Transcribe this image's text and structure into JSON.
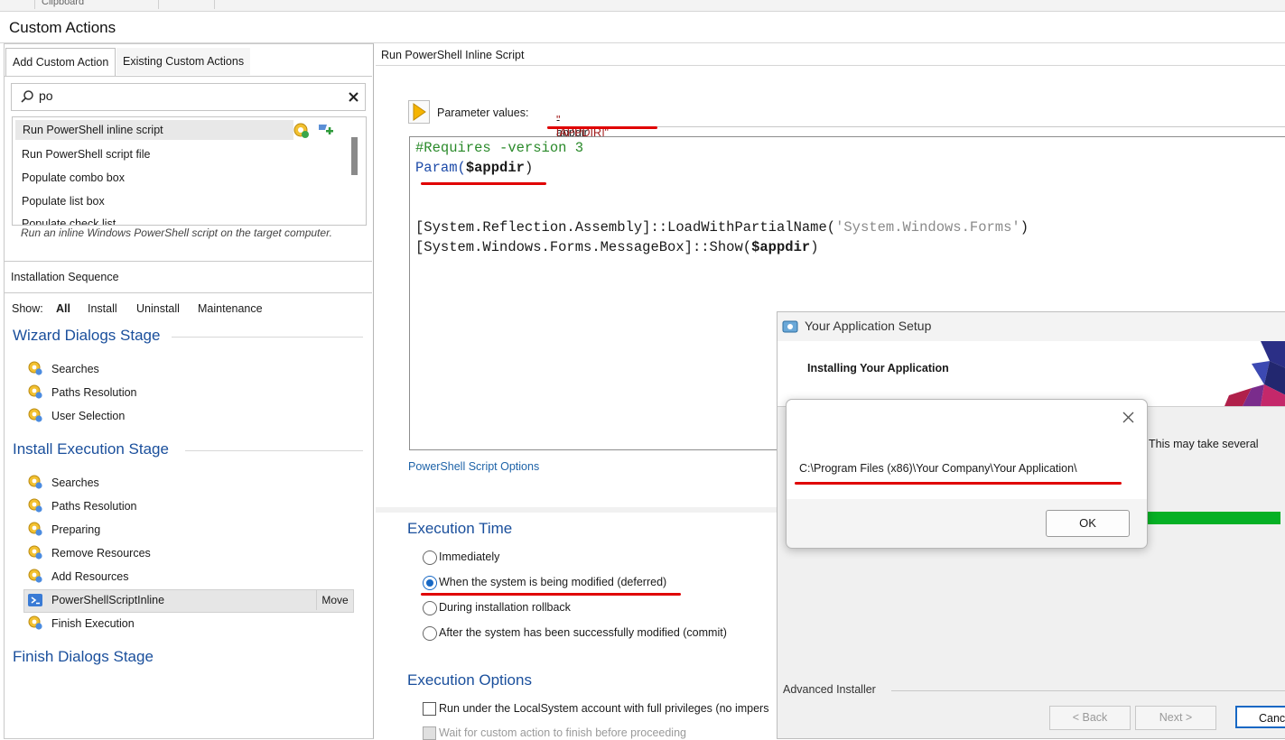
{
  "ribbon": {
    "group_label": "Clipboard"
  },
  "window_title": "Custom Actions",
  "left": {
    "tabs": [
      "Add Custom Action",
      "Existing Custom Actions"
    ],
    "search": {
      "value": "po"
    },
    "actions": [
      "Run PowerShell inline script",
      "Run PowerShell script file",
      "Populate combo box",
      "Populate list box",
      "Populate check list"
    ],
    "description": "Run an inline Windows PowerShell script on the target computer."
  },
  "sequence": {
    "header": "Installation Sequence",
    "show_label": "Show:",
    "filters": [
      "All",
      "Install",
      "Uninstall",
      "Maintenance"
    ],
    "stages": [
      {
        "title": "Wizard Dialogs Stage",
        "items": [
          "Searches",
          "Paths Resolution",
          "User Selection"
        ]
      },
      {
        "title": "Install Execution Stage",
        "items": [
          "Searches",
          "Paths Resolution",
          "Preparing",
          "Remove Resources",
          "Add Resources",
          "PowerShellScriptInline",
          "Finish Execution"
        ]
      },
      {
        "title": "Finish Dialogs Stage",
        "items": []
      }
    ],
    "move_label": "Move"
  },
  "right": {
    "header": "Run PowerShell Inline Script",
    "param_label": "Parameter values:",
    "param_value_prefix": "-appdir ",
    "param_value_quoted": "\"[APPDIR]\"",
    "code": {
      "l1": "#Requires -version 3",
      "l2a": "Param(",
      "l2b": "$appdir",
      "l2c": ")",
      "l3a": "[System.Reflection.Assembly]::LoadWithPartialName(",
      "l3b": "'System.Windows.Forms'",
      "l3c": ")",
      "l4a": "[System.Windows.Forms.MessageBox]::Show(",
      "l4b": "$appdir",
      "l4c": ")"
    },
    "options_link": "PowerShell Script Options",
    "execution_time": {
      "title": "Execution Time",
      "options": [
        "Immediately",
        "When the system is being modified (deferred)",
        "During installation rollback",
        "After the system has been successfully modified (commit)"
      ],
      "selected": 1
    },
    "execution_options": {
      "title": "Execution Options",
      "items": [
        "Run under the LocalSystem account with full privileges (no impers",
        "Wait for custom action to finish before proceeding"
      ]
    }
  },
  "setup": {
    "title": "Your Application Setup",
    "banner": "Installing Your Application",
    "status": "This may take several",
    "brand": "Advanced Installer",
    "progress": 1.0,
    "buttons": [
      "< Back",
      "Next >",
      "Canc"
    ]
  },
  "messagebox": {
    "text": "C:\\Program Files (x86)\\Your Company\\Your Application\\",
    "ok": "OK"
  },
  "colors": {
    "accent": "#1a4f9c",
    "link": "#1e63a8",
    "annotation": "#e00000",
    "progress": "#06b025"
  }
}
